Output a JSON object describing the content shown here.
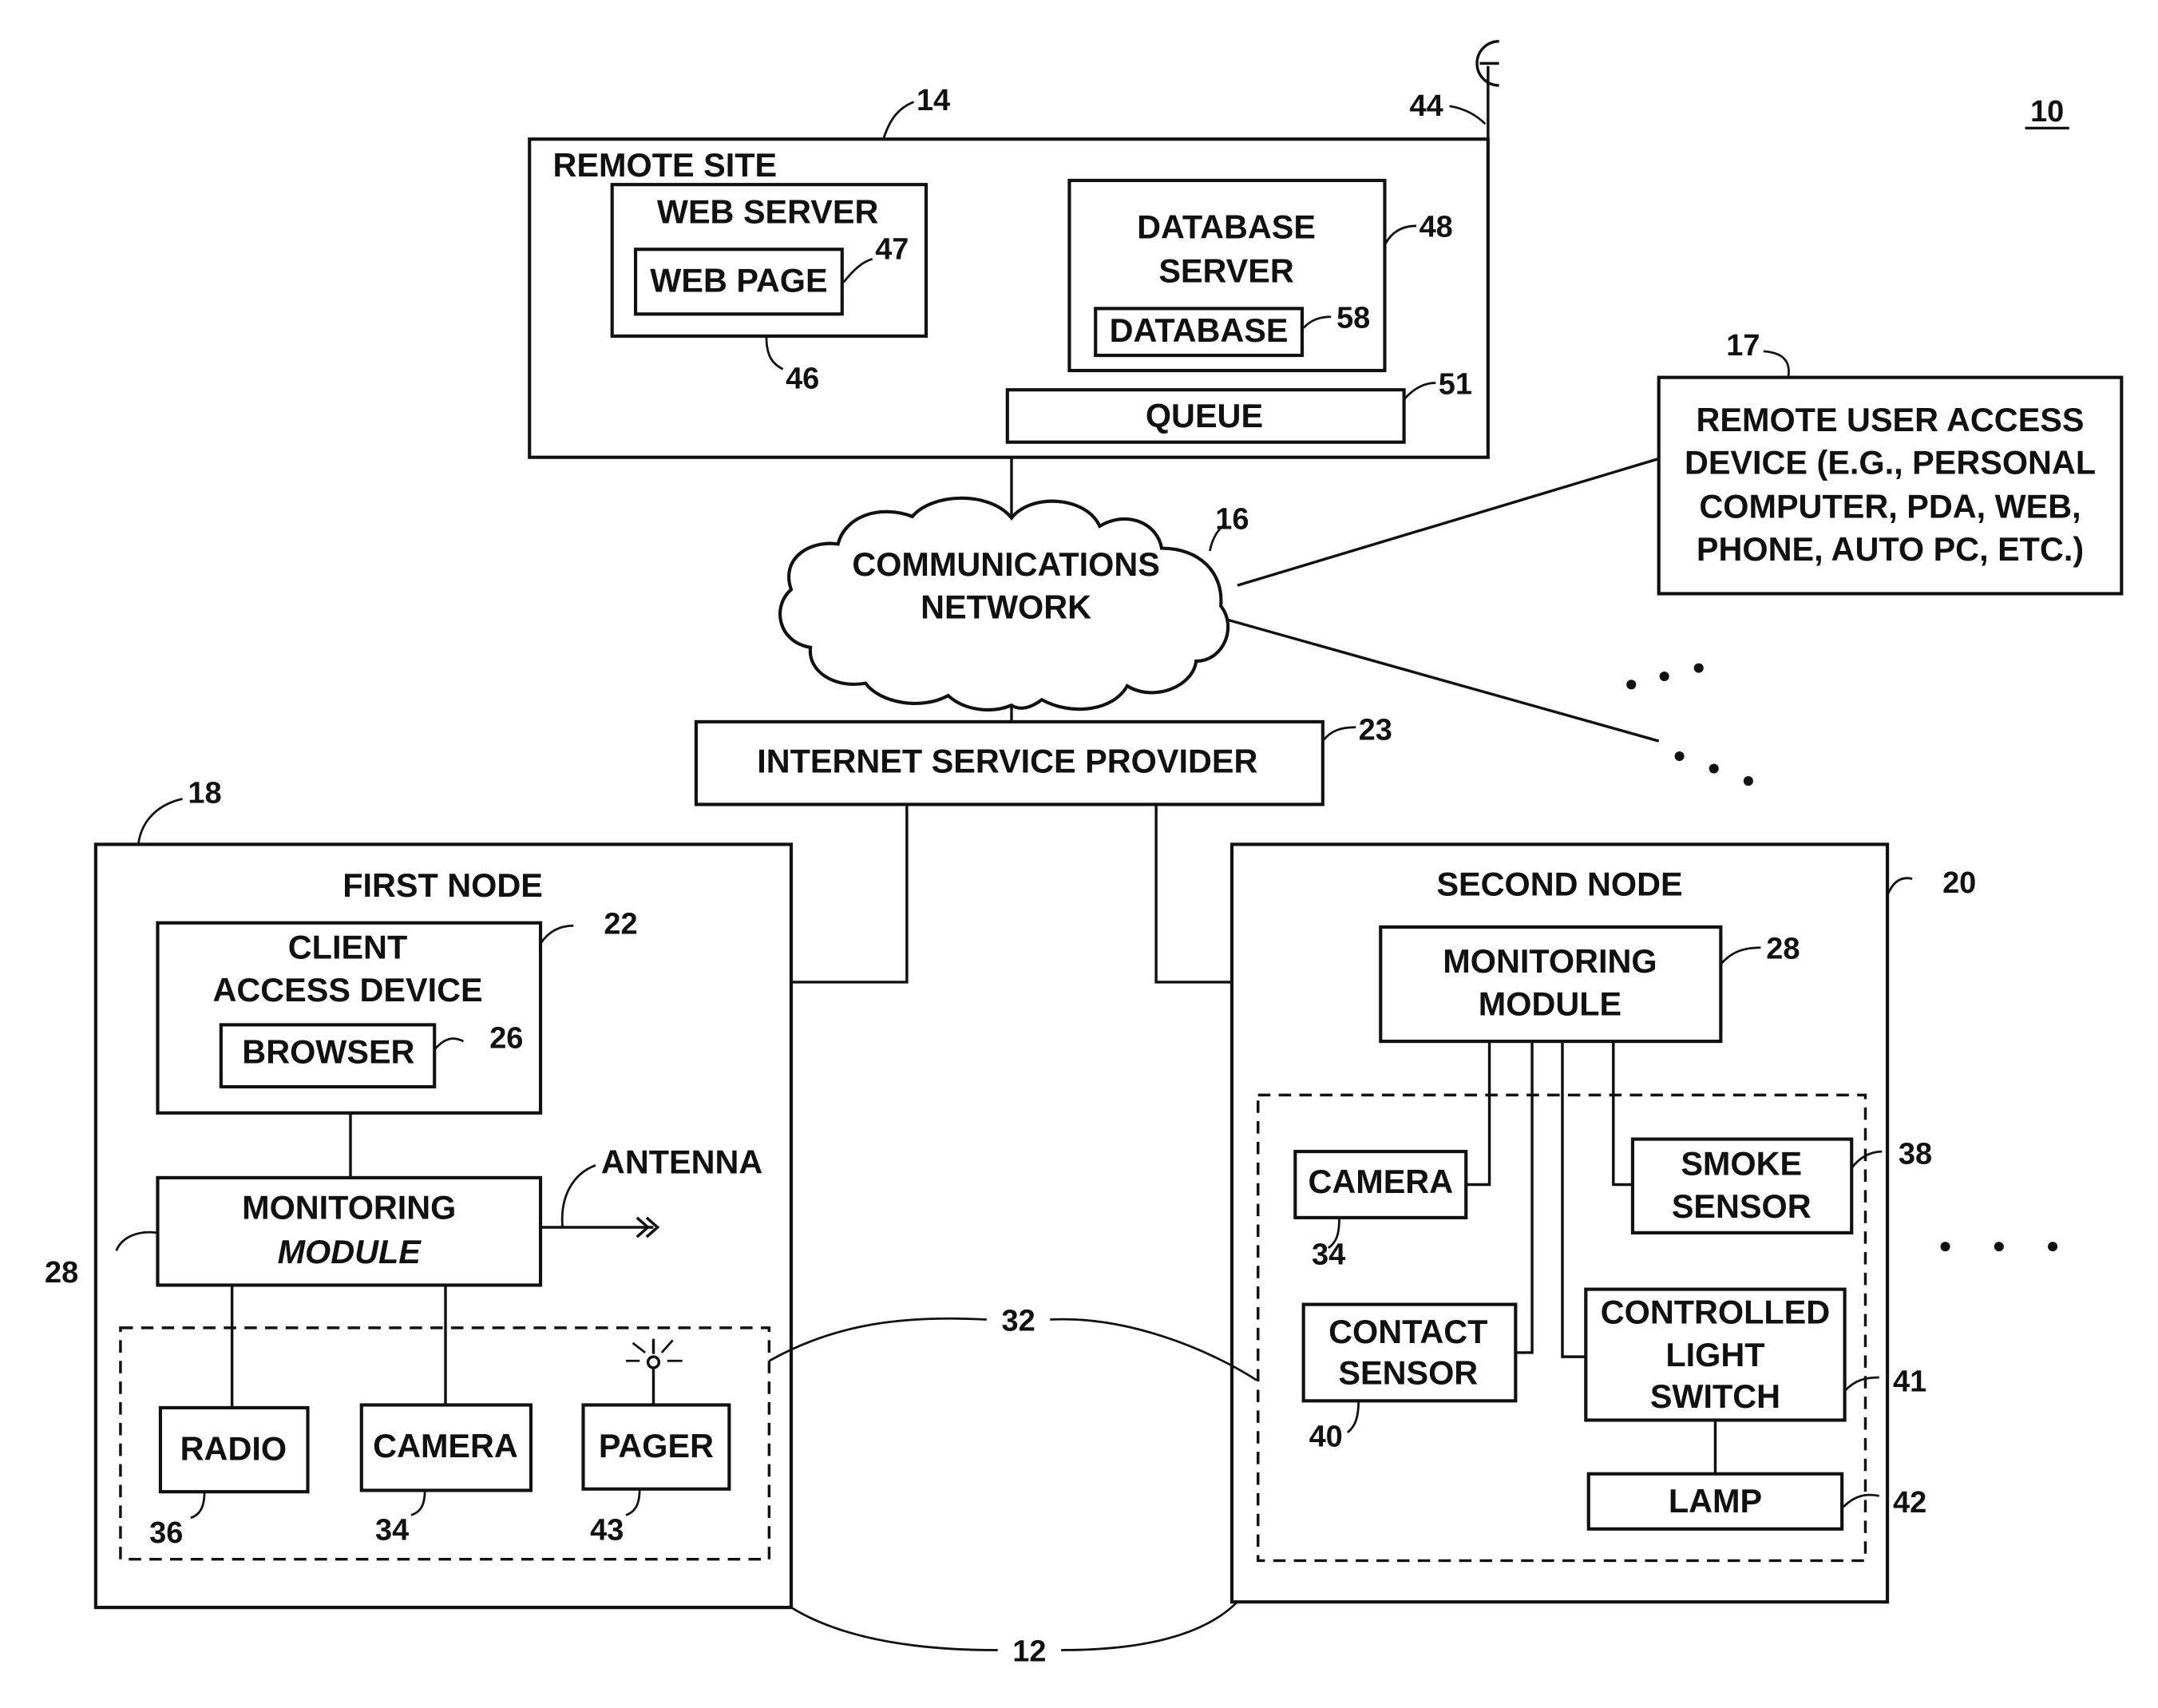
{
  "figure_number": "10",
  "remote_site": {
    "ref": "14",
    "label": "REMOTE SITE",
    "antenna_ref": "44",
    "web_server": {
      "ref": "46",
      "label": "WEB SERVER",
      "web_page": {
        "ref": "47",
        "label": "WEB PAGE"
      }
    },
    "database_server": {
      "ref": "48",
      "label_line1": "DATABASE",
      "label_line2": "SERVER",
      "database": {
        "ref": "58",
        "label": "DATABASE"
      }
    },
    "queue": {
      "ref": "51",
      "label": "QUEUE"
    }
  },
  "network": {
    "ref": "16",
    "label_line1": "COMMUNICATIONS",
    "label_line2": "NETWORK"
  },
  "remote_user": {
    "ref": "17",
    "lines": [
      "REMOTE USER ACCESS",
      "DEVICE (E.G., PERSONAL",
      "COMPUTER, PDA, WEB,",
      "PHONE, AUTO PC, ETC.)"
    ]
  },
  "isp": {
    "ref": "23",
    "label": "INTERNET SERVICE PROVIDER"
  },
  "first_node": {
    "ref": "18",
    "label": "FIRST NODE",
    "client": {
      "ref": "22",
      "label_line1": "CLIENT",
      "label_line2": "ACCESS DEVICE",
      "browser": {
        "ref": "26",
        "label": "BROWSER"
      }
    },
    "monitor": {
      "ref": "28",
      "label_line1": "MONITORING",
      "label_line2": "MODULE"
    },
    "antenna_label": "ANTENNA",
    "devices": [
      {
        "ref": "36",
        "label": "RADIO"
      },
      {
        "ref": "34",
        "label": "CAMERA"
      },
      {
        "ref": "43",
        "label": "PAGER"
      }
    ]
  },
  "second_node": {
    "ref": "20",
    "label": "SECOND NODE",
    "monitor": {
      "ref": "28",
      "label_line1": "MONITORING",
      "label_line2": "MODULE"
    },
    "camera": {
      "ref": "34",
      "label": "CAMERA"
    },
    "smoke": {
      "ref": "38",
      "label_line1": "SMOKE",
      "label_line2": "SENSOR"
    },
    "contact": {
      "ref": "40",
      "label_line1": "CONTACT",
      "label_line2": "SENSOR"
    },
    "switch": {
      "ref": "41",
      "label_line1": "CONTROLLED",
      "label_line2": "LIGHT",
      "label_line3": "SWITCH"
    },
    "lamp": {
      "ref": "42",
      "label": "LAMP"
    }
  },
  "device_group_ref": "32",
  "nodes_group_ref": "12"
}
